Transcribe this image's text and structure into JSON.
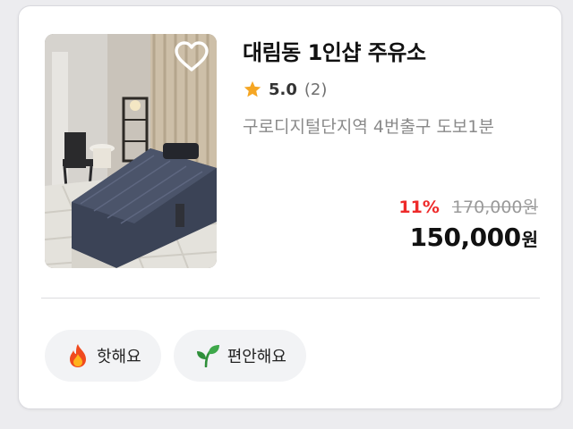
{
  "listing": {
    "title": "대림동 1인샵 주유소",
    "rating": "5.0",
    "review_count": "(2)",
    "location": "구로디지털단지역 4번출구 도보1분",
    "discount": "11%",
    "original_price": "170,000원",
    "final_price": "150,000",
    "currency": "원",
    "favorite_icon": "heart-outline-icon",
    "rating_icon": "star-icon"
  },
  "tags": [
    {
      "label": "핫해요",
      "icon": "fire-icon"
    },
    {
      "label": "편안해요",
      "icon": "sprout-icon"
    }
  ],
  "colors": {
    "discount": "#ee2a2a",
    "star": "#f5a623",
    "tag_background": "#f2f3f5",
    "text_primary": "#111111",
    "text_secondary": "#8a8a8a"
  }
}
